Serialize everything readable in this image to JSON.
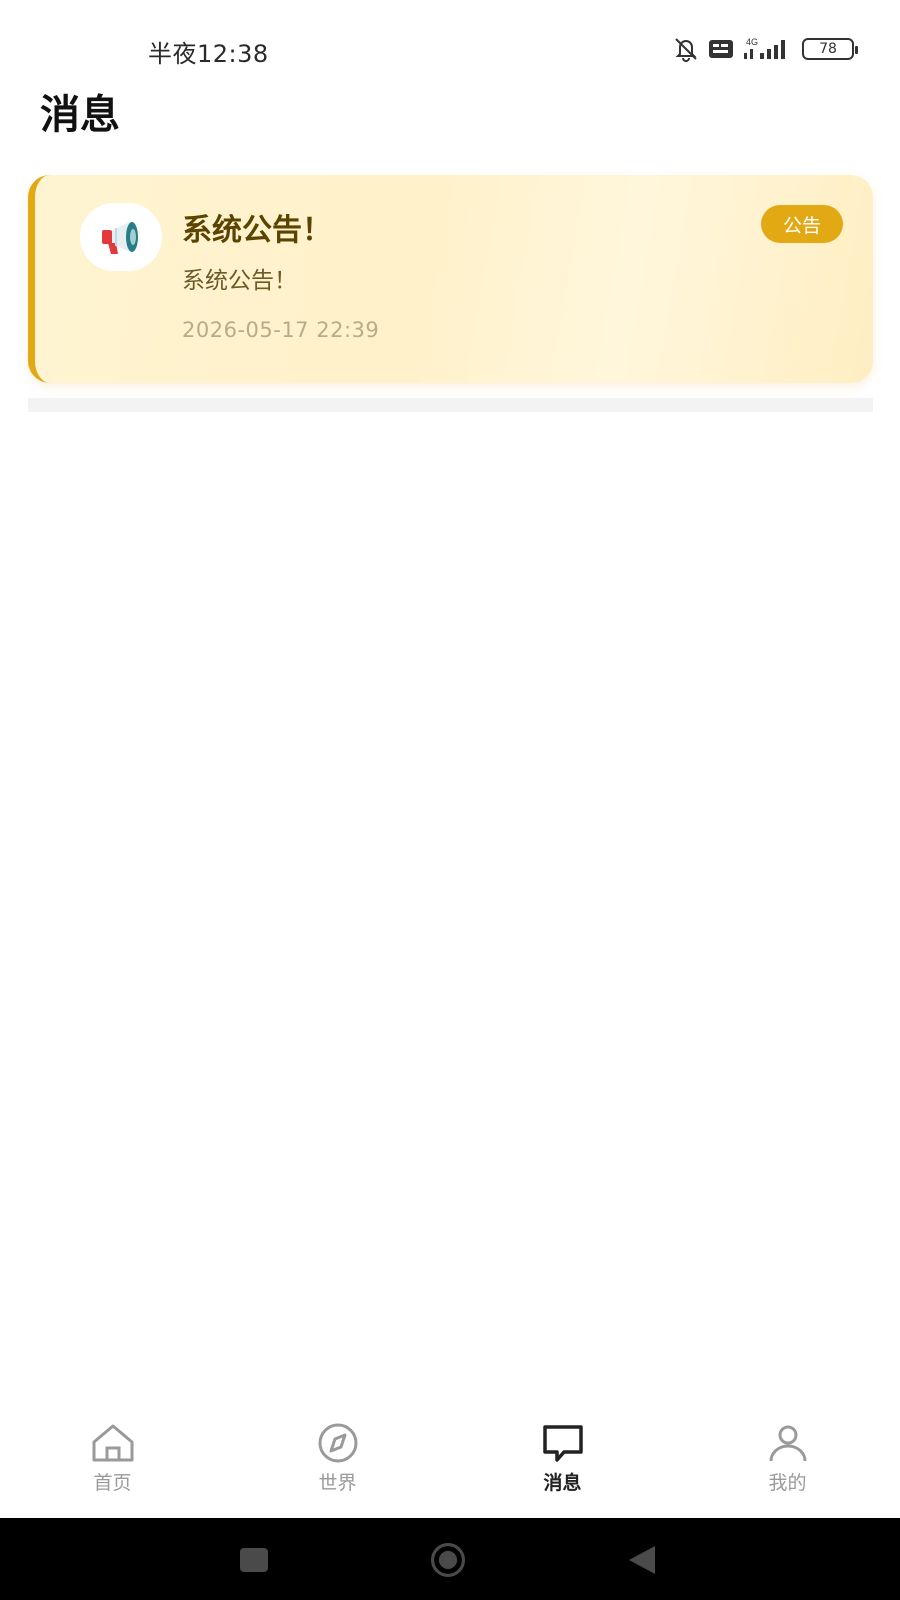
{
  "status_bar": {
    "time": "半夜12:38",
    "network_label": "4G",
    "volte_label": "Vo LTE",
    "battery": "78",
    "icons": [
      "mute-bell-icon",
      "volte-icon",
      "signal-icon",
      "battery-icon"
    ]
  },
  "header": {
    "title": "消息"
  },
  "messages": [
    {
      "title": "系统公告！",
      "body": "系统公告！",
      "time": "2026-05-17 22:39",
      "badge": "公告",
      "icon": "megaphone-icon"
    }
  ],
  "tabs": [
    {
      "label": "首页",
      "icon": "home-icon",
      "active": false
    },
    {
      "label": "世界",
      "icon": "compass-icon",
      "active": false
    },
    {
      "label": "消息",
      "icon": "chat-bubble-icon",
      "active": true
    },
    {
      "label": "我的",
      "icon": "person-icon",
      "active": false
    }
  ],
  "system_nav": {
    "icons": [
      "recents-square-icon",
      "home-circle-icon",
      "back-triangle-icon"
    ]
  },
  "colors": {
    "accent": "#e2a915",
    "card_background": "#fff3cf",
    "card_title": "#5b4400",
    "tab_inactive": "#9a9a9a",
    "tab_active": "#222222"
  }
}
